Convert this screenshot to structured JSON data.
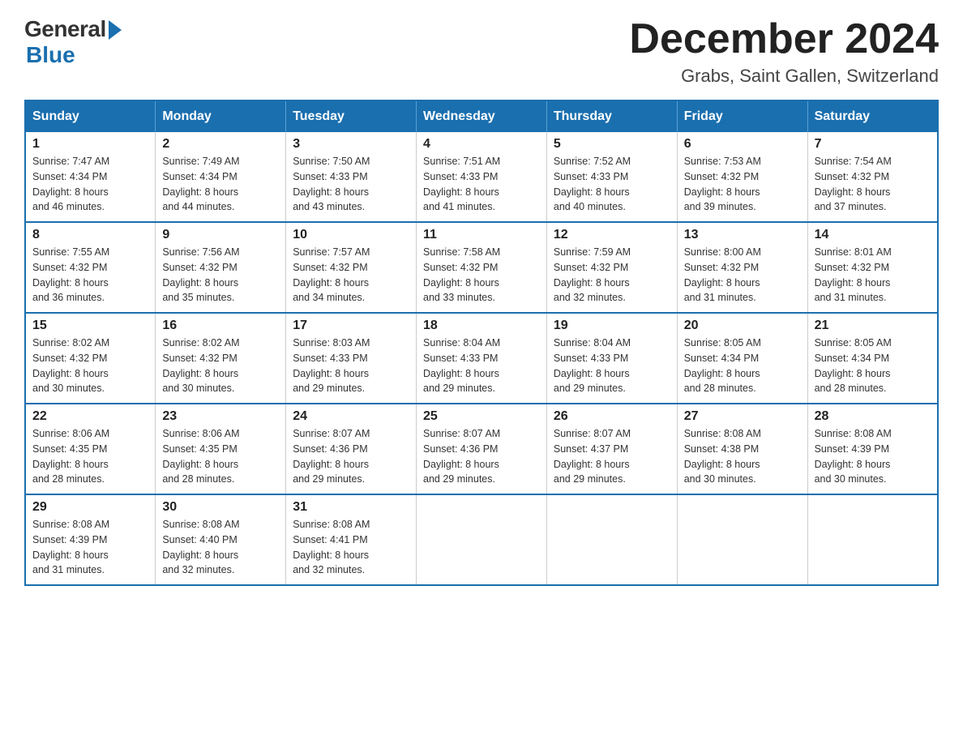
{
  "header": {
    "logo_general": "General",
    "logo_blue": "Blue",
    "month_title": "December 2024",
    "subtitle": "Grabs, Saint Gallen, Switzerland"
  },
  "weekdays": [
    "Sunday",
    "Monday",
    "Tuesday",
    "Wednesday",
    "Thursday",
    "Friday",
    "Saturday"
  ],
  "weeks": [
    [
      {
        "day": "1",
        "sunrise": "7:47 AM",
        "sunset": "4:34 PM",
        "daylight": "8 hours and 46 minutes."
      },
      {
        "day": "2",
        "sunrise": "7:49 AM",
        "sunset": "4:34 PM",
        "daylight": "8 hours and 44 minutes."
      },
      {
        "day": "3",
        "sunrise": "7:50 AM",
        "sunset": "4:33 PM",
        "daylight": "8 hours and 43 minutes."
      },
      {
        "day": "4",
        "sunrise": "7:51 AM",
        "sunset": "4:33 PM",
        "daylight": "8 hours and 41 minutes."
      },
      {
        "day": "5",
        "sunrise": "7:52 AM",
        "sunset": "4:33 PM",
        "daylight": "8 hours and 40 minutes."
      },
      {
        "day": "6",
        "sunrise": "7:53 AM",
        "sunset": "4:32 PM",
        "daylight": "8 hours and 39 minutes."
      },
      {
        "day": "7",
        "sunrise": "7:54 AM",
        "sunset": "4:32 PM",
        "daylight": "8 hours and 37 minutes."
      }
    ],
    [
      {
        "day": "8",
        "sunrise": "7:55 AM",
        "sunset": "4:32 PM",
        "daylight": "8 hours and 36 minutes."
      },
      {
        "day": "9",
        "sunrise": "7:56 AM",
        "sunset": "4:32 PM",
        "daylight": "8 hours and 35 minutes."
      },
      {
        "day": "10",
        "sunrise": "7:57 AM",
        "sunset": "4:32 PM",
        "daylight": "8 hours and 34 minutes."
      },
      {
        "day": "11",
        "sunrise": "7:58 AM",
        "sunset": "4:32 PM",
        "daylight": "8 hours and 33 minutes."
      },
      {
        "day": "12",
        "sunrise": "7:59 AM",
        "sunset": "4:32 PM",
        "daylight": "8 hours and 32 minutes."
      },
      {
        "day": "13",
        "sunrise": "8:00 AM",
        "sunset": "4:32 PM",
        "daylight": "8 hours and 31 minutes."
      },
      {
        "day": "14",
        "sunrise": "8:01 AM",
        "sunset": "4:32 PM",
        "daylight": "8 hours and 31 minutes."
      }
    ],
    [
      {
        "day": "15",
        "sunrise": "8:02 AM",
        "sunset": "4:32 PM",
        "daylight": "8 hours and 30 minutes."
      },
      {
        "day": "16",
        "sunrise": "8:02 AM",
        "sunset": "4:32 PM",
        "daylight": "8 hours and 30 minutes."
      },
      {
        "day": "17",
        "sunrise": "8:03 AM",
        "sunset": "4:33 PM",
        "daylight": "8 hours and 29 minutes."
      },
      {
        "day": "18",
        "sunrise": "8:04 AM",
        "sunset": "4:33 PM",
        "daylight": "8 hours and 29 minutes."
      },
      {
        "day": "19",
        "sunrise": "8:04 AM",
        "sunset": "4:33 PM",
        "daylight": "8 hours and 29 minutes."
      },
      {
        "day": "20",
        "sunrise": "8:05 AM",
        "sunset": "4:34 PM",
        "daylight": "8 hours and 28 minutes."
      },
      {
        "day": "21",
        "sunrise": "8:05 AM",
        "sunset": "4:34 PM",
        "daylight": "8 hours and 28 minutes."
      }
    ],
    [
      {
        "day": "22",
        "sunrise": "8:06 AM",
        "sunset": "4:35 PM",
        "daylight": "8 hours and 28 minutes."
      },
      {
        "day": "23",
        "sunrise": "8:06 AM",
        "sunset": "4:35 PM",
        "daylight": "8 hours and 28 minutes."
      },
      {
        "day": "24",
        "sunrise": "8:07 AM",
        "sunset": "4:36 PM",
        "daylight": "8 hours and 29 minutes."
      },
      {
        "day": "25",
        "sunrise": "8:07 AM",
        "sunset": "4:36 PM",
        "daylight": "8 hours and 29 minutes."
      },
      {
        "day": "26",
        "sunrise": "8:07 AM",
        "sunset": "4:37 PM",
        "daylight": "8 hours and 29 minutes."
      },
      {
        "day": "27",
        "sunrise": "8:08 AM",
        "sunset": "4:38 PM",
        "daylight": "8 hours and 30 minutes."
      },
      {
        "day": "28",
        "sunrise": "8:08 AM",
        "sunset": "4:39 PM",
        "daylight": "8 hours and 30 minutes."
      }
    ],
    [
      {
        "day": "29",
        "sunrise": "8:08 AM",
        "sunset": "4:39 PM",
        "daylight": "8 hours and 31 minutes."
      },
      {
        "day": "30",
        "sunrise": "8:08 AM",
        "sunset": "4:40 PM",
        "daylight": "8 hours and 32 minutes."
      },
      {
        "day": "31",
        "sunrise": "8:08 AM",
        "sunset": "4:41 PM",
        "daylight": "8 hours and 32 minutes."
      },
      null,
      null,
      null,
      null
    ]
  ],
  "labels": {
    "sunrise": "Sunrise: ",
    "sunset": "Sunset: ",
    "daylight": "Daylight: "
  }
}
